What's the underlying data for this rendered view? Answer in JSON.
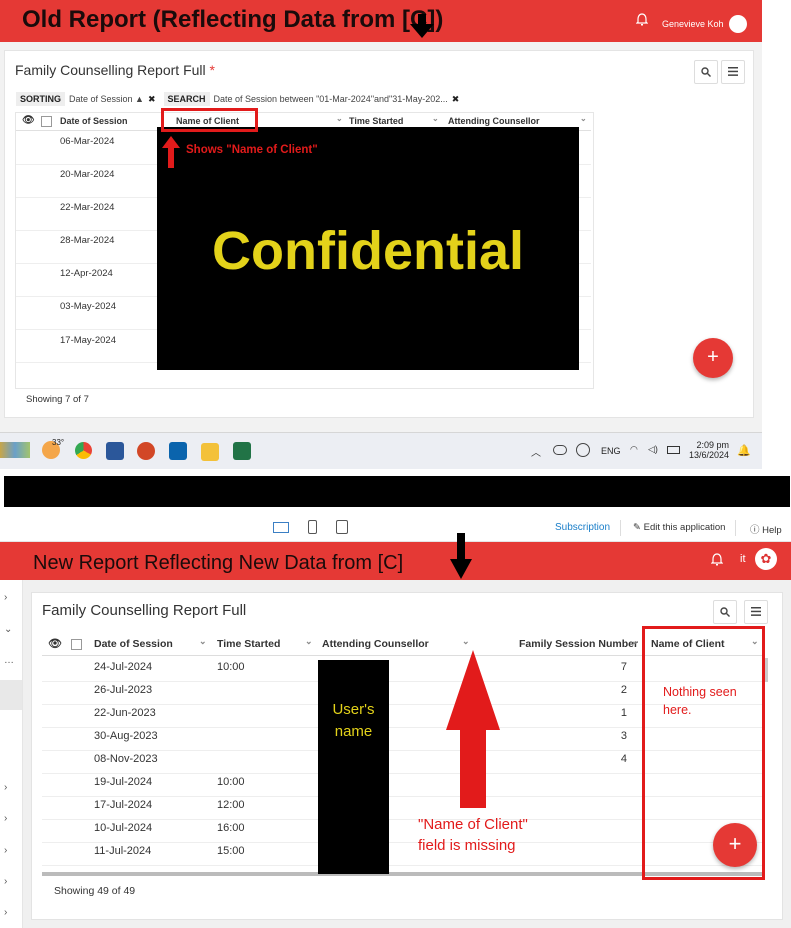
{
  "top_panel": {
    "title": "Old Report (Reflecting Data from [C])",
    "user_name": "Genevieve Koh",
    "report_title": "Family Counselling Report Full",
    "required_mark": "*",
    "sorting_label": "SORTING",
    "sorting_value": "Date of Session ▲",
    "search_label": "SEARCH",
    "search_value": "Date of Session between \"01-Mar-2024\"and\"31-May-202...",
    "columns": [
      "Date of Session",
      "Name of Client",
      "Time Started",
      "Attending Counsellor"
    ],
    "rows": [
      "06-Mar-2024",
      "20-Mar-2024",
      "22-Mar-2024",
      "28-Mar-2024",
      "12-Apr-2024",
      "03-May-2024",
      "17-May-2024"
    ],
    "showing": "Showing 7 of 7",
    "confidential_label": "Confidential",
    "annotation": "Shows \"Name of Client\"",
    "fab_label": "+"
  },
  "taskbar": {
    "weather": "33°",
    "language": "ENG",
    "time": "2:09 pm",
    "date": "13/6/2024",
    "apps": [
      "weather-icon",
      "chrome-icon",
      "word-icon",
      "powerpoint-icon",
      "outlook-icon",
      "file-explorer-icon",
      "excel-icon"
    ]
  },
  "bottom_panel": {
    "subscription": "Subscription",
    "edit_app": "Edit this application",
    "help": "Help",
    "title": "New Report Reflecting New Data from [C]",
    "user_initials": "it",
    "report_title": "Family Counselling Report Full",
    "columns": [
      "Date of Session",
      "Time Started",
      "Attending Counsellor",
      "Family Session Number",
      "Name of Client"
    ],
    "rows": [
      {
        "date": "24-Jul-2024",
        "time": "10:00",
        "num": "7"
      },
      {
        "date": "26-Jul-2023",
        "time": "",
        "num": "2"
      },
      {
        "date": "22-Jun-2023",
        "time": "",
        "num": "1"
      },
      {
        "date": "30-Aug-2023",
        "time": "",
        "num": "3"
      },
      {
        "date": "08-Nov-2023",
        "time": "",
        "num": "4"
      },
      {
        "date": "19-Jul-2024",
        "time": "10:00",
        "num": ""
      },
      {
        "date": "17-Jul-2024",
        "time": "12:00",
        "num": ""
      },
      {
        "date": "10-Jul-2024",
        "time": "16:00",
        "num": ""
      },
      {
        "date": "11-Jul-2024",
        "time": "15:00",
        "num": ""
      }
    ],
    "showing": "Showing 49 of 49",
    "users_name_label": "User's name",
    "nothing_annotation": "Nothing seen here.",
    "missing_annotation": "\"Name of Client\" field is missing",
    "fab_label": "+"
  },
  "colors": {
    "brand_red": "#e53935",
    "annotation_red": "#e21b1b",
    "redaction_text": "#e3d21a"
  }
}
